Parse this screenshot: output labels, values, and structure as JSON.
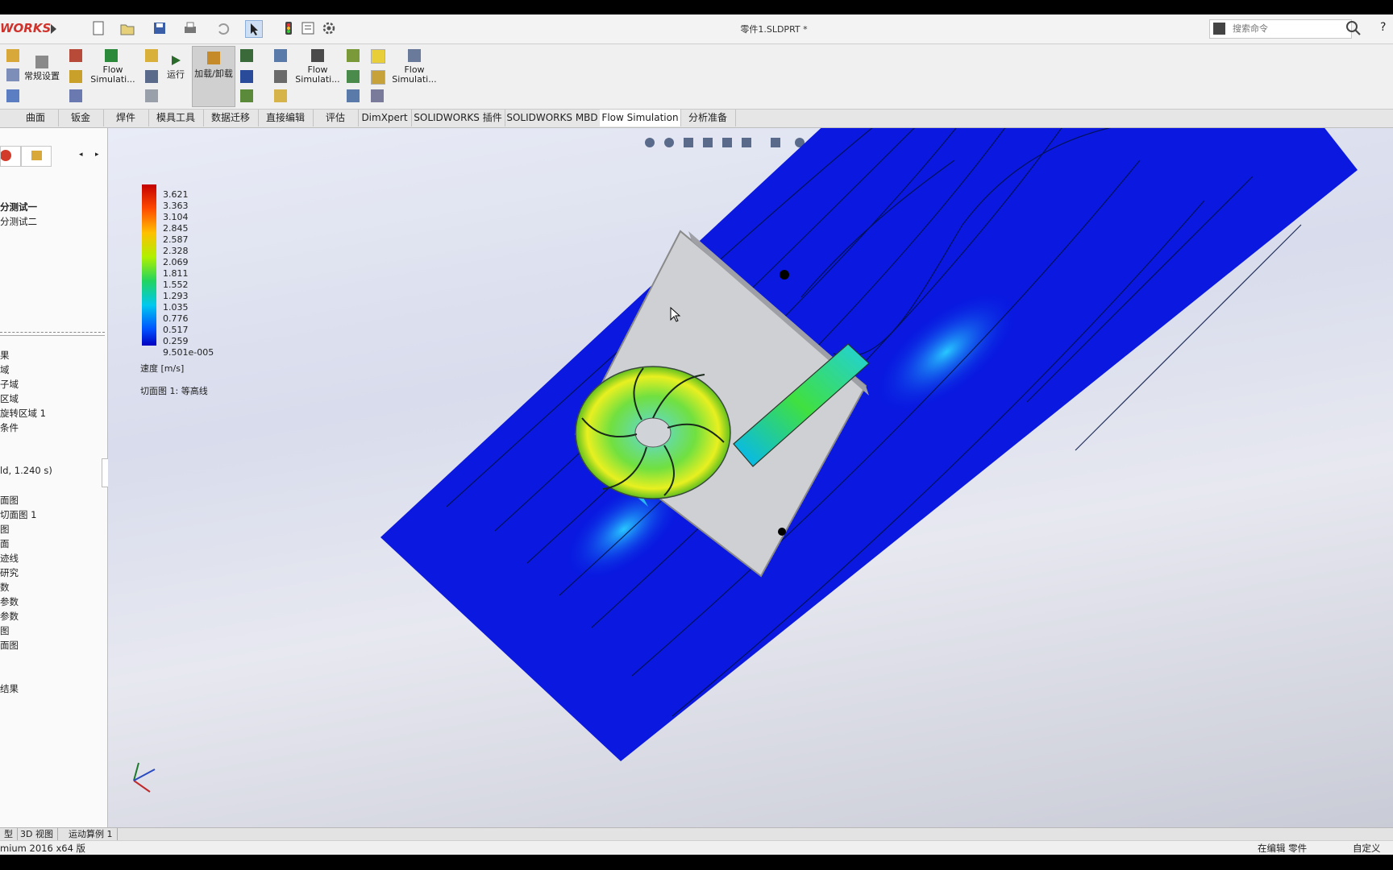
{
  "app": {
    "brand": "WORKS",
    "document_title": "零件1.SLDPRT *"
  },
  "search": {
    "placeholder": "搜索命令"
  },
  "ribbon": {
    "general_settings": "常规设置",
    "flow_sim_1": "Flow Simulati...",
    "run": "运行",
    "load_unload": "加载/卸载",
    "flow_sim_2": "Flow Simulati...",
    "flow_sim_3": "Flow Simulati..."
  },
  "tabs": [
    "曲面",
    "钣金",
    "焊件",
    "模具工具",
    "数据迁移",
    "直接编辑",
    "评估",
    "DimXpert",
    "SOLIDWORKS 插件",
    "SOLIDWORKS MBD",
    "Flow Simulation",
    "分析准备"
  ],
  "active_tab": "Flow Simulation",
  "tree": {
    "projects": [
      "分测试一",
      "分测试二"
    ],
    "items": [
      "果",
      "域",
      "子域",
      "区域",
      "旋转区域 1",
      "条件",
      "",
      "",
      "ld, 1.240 s)",
      "",
      "面图",
      "切面图 1",
      "图",
      "面",
      "迹线",
      "研究",
      "数",
      "参数",
      "参数",
      "图",
      "面图",
      "",
      "",
      "结果"
    ]
  },
  "legend": {
    "values": [
      "3.621",
      "3.363",
      "3.104",
      "2.845",
      "2.587",
      "2.328",
      "2.069",
      "1.811",
      "1.552",
      "1.293",
      "1.035",
      "0.776",
      "0.517",
      "0.259",
      "9.501e-005"
    ],
    "unit_label": "速度 [m/s]",
    "caption": "切面图 1: 等高线",
    "colors": [
      "#c40000",
      "#ff2a00",
      "#ff7a00",
      "#ffc000",
      "#f6f000",
      "#c0f000",
      "#70e000",
      "#20d400",
      "#00d06a",
      "#00d4c0",
      "#00c8f0",
      "#0090ff",
      "#0050ff",
      "#0020f0",
      "#0000c0"
    ]
  },
  "bottom_tabs": [
    "型",
    "3D 视图",
    "运动算例 1"
  ],
  "status": {
    "left": "mium 2016 x64 版",
    "editing": "在编辑 零件",
    "custom": "自定义"
  }
}
